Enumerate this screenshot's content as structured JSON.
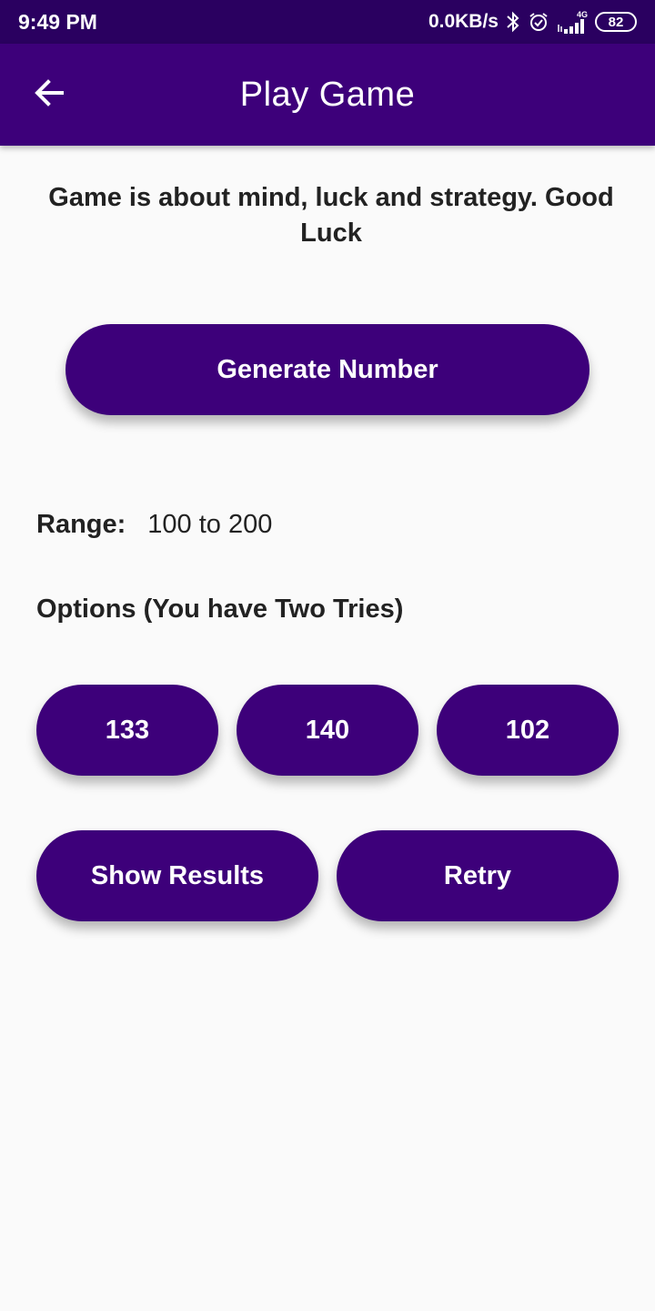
{
  "status_bar": {
    "time": "9:49 PM",
    "network_speed": "0.0KB/s",
    "network_type": "4G",
    "battery": "82",
    "icons": [
      "bluetooth-icon",
      "alarm-icon",
      "signal-icon",
      "battery-icon"
    ]
  },
  "app_bar": {
    "title": "Play Game",
    "back_icon": "arrow-back-icon"
  },
  "main": {
    "tagline": "Game is about mind, luck and strategy. Good Luck",
    "generate_label": "Generate Number",
    "range_label": "Range:",
    "range_value": "100 to 200",
    "options_label": "Options (You have Two Tries)",
    "options": [
      "133",
      "140",
      "102"
    ],
    "show_results_label": "Show Results",
    "retry_label": "Retry"
  },
  "colors": {
    "status_bar": "#2a0060",
    "primary": "#3d007a",
    "background": "#fafafa",
    "text": "#222222"
  }
}
